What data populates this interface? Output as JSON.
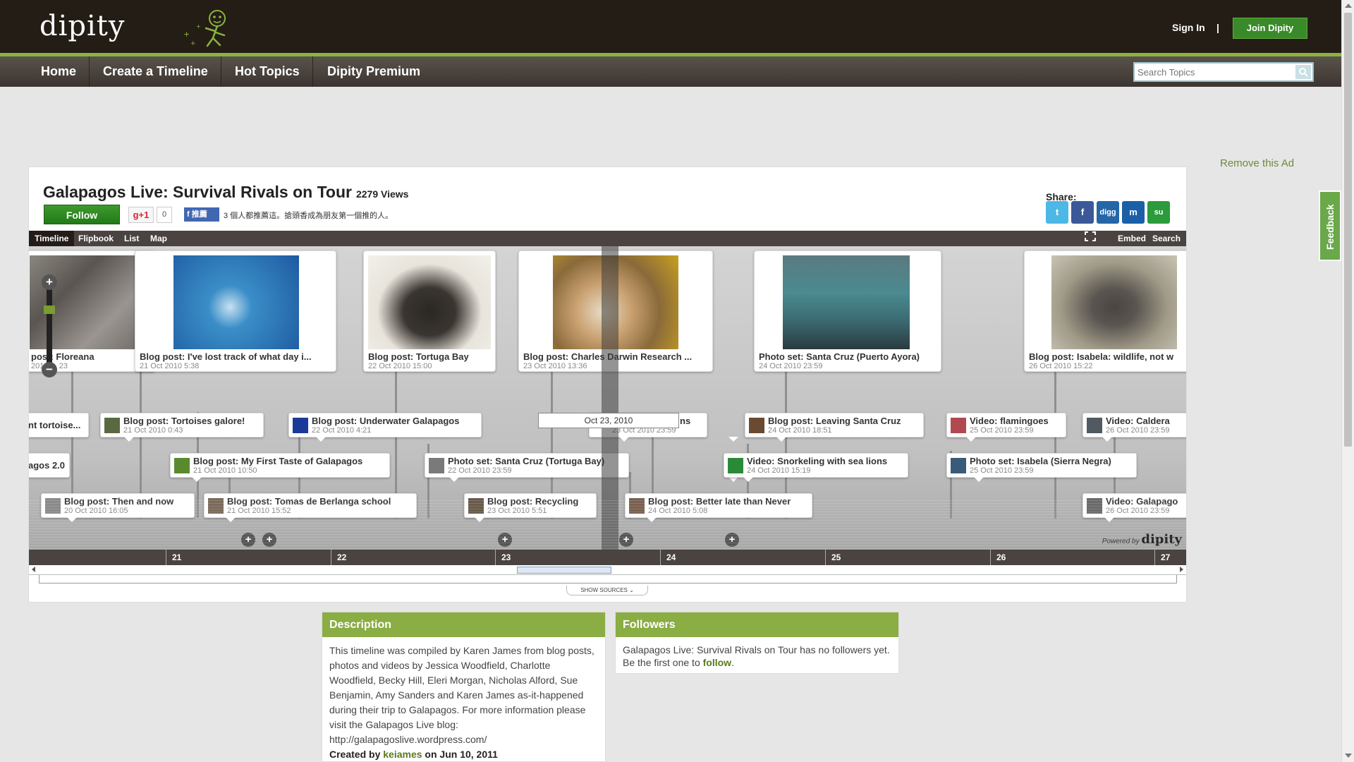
{
  "header": {
    "logo_text": "dipity",
    "signin": "Sign In",
    "separator": "|",
    "join": "Join Dipity"
  },
  "nav": {
    "items": [
      "Home",
      "Create a Timeline",
      "Hot Topics",
      "Dipity Premium"
    ],
    "search_placeholder": "Search Topics"
  },
  "ad": {
    "remove": "Remove this Ad"
  },
  "feedback": "Feedback",
  "timeline": {
    "title": "Galapagos Live: Survival Rivals on Tour",
    "views": "2279 Views",
    "follow": "Follow",
    "gplus": "g+1",
    "gplus_count": "0",
    "fb_button": "推薦",
    "fb_text": "3 個人都推薦這。搶頭香成為朋友第一個推的人。",
    "share_label": "Share:",
    "share_icons": [
      "twitter-icon",
      "facebook-icon",
      "digg-icon",
      "myspace-icon",
      "stumbleupon-icon"
    ],
    "share_glyphs": [
      "t",
      "f",
      "digg",
      "m",
      "su"
    ],
    "tabs": [
      "Timeline",
      "Flipbook",
      "List",
      "Map"
    ],
    "right_tabs": [
      "Embed",
      "Search"
    ],
    "cards": [
      {
        "title": "post: Floreana",
        "date": "2010 ... 23"
      },
      {
        "title": "Blog post: I've lost track of what day i...",
        "date": "21 Oct 2010 5:38"
      },
      {
        "title": "Blog post: Tortuga Bay",
        "date": "22 Oct 2010 15:00"
      },
      {
        "title": "Blog post: Charles Darwin Research ...",
        "date": "23 Oct 2010 13:36"
      },
      {
        "title": "Photo set: Santa Cruz (Puerto Ayora)",
        "date": "24 Oct 2010 23:59"
      },
      {
        "title": "Blog post: Isabela: wildlife, not w",
        "date": "26 Oct 2010 15:22"
      }
    ],
    "events": [
      {
        "title": "nt tortoise...",
        "date": ""
      },
      {
        "title": "Blog post: Tortoises galore!",
        "date": "21 Oct 2010 0:43"
      },
      {
        "title": "Blog post: Underwater Galapagos",
        "date": "22 Oct 2010 4:21"
      },
      {
        "title": "ns",
        "date": "23 Oct 2010 23:59"
      },
      {
        "title": "Blog post: Leaving Santa Cruz",
        "date": "24 Oct 2010 18:51"
      },
      {
        "title": "Video: flamingoes",
        "date": "25 Oct 2010 23:59"
      },
      {
        "title": "Video: Caldera",
        "date": "26 Oct 2010 23:59"
      },
      {
        "title": "agos 2.0",
        "date": ""
      },
      {
        "title": "Blog post: My First Taste of Galapagos",
        "date": "21 Oct 2010 10:50"
      },
      {
        "title": "Photo set: Santa Cruz (Tortuga Bay)",
        "date": "22 Oct 2010 23:59"
      },
      {
        "title": "Video: Snorkeling with sea lions",
        "date": "24 Oct 2010 15:19"
      },
      {
        "title": "Photo set: Isabela (Sierra Negra)",
        "date": "25 Oct 2010 23:59"
      },
      {
        "title": "Blog post: Then and now",
        "date": "20 Oct 2010 16:05"
      },
      {
        "title": "Blog post: Tomas de Berlanga school",
        "date": "21 Oct 2010 15:52"
      },
      {
        "title": "Blog post: Recycling",
        "date": "23 Oct 2010 5:51"
      },
      {
        "title": "Blog post: Better late than Never",
        "date": "24 Oct 2010 5:08"
      },
      {
        "title": "Video: Galapago",
        "date": "26 Oct 2010 23:59"
      }
    ],
    "cursor_label": "Oct 23, 2010",
    "powered_by": "Powered by",
    "powered_logo": "dipity",
    "axis_ticks": [
      "21",
      "22",
      "23",
      "24",
      "25",
      "26",
      "27"
    ],
    "show_sources": "SHOW SOURCES"
  },
  "description": {
    "heading": "Description",
    "text": "This timeline was compiled by Karen James from blog posts, photos and videos by Jessica Woodfield, Charlotte Woodfield, Becky Hill, Eleri Morgan, Nicholas Alford, Sue Benjamin, Amy Sanders and Karen James as-it-happened during their trip to Galapagos. For more information please visit the Galapagos Live blog: http://galapagoslive.wordpress.com/",
    "created_prefix": "Created by",
    "created_user": "keiames",
    "created_suffix": "on Jun 10, 2011"
  },
  "followers": {
    "heading": "Followers",
    "text": "Galapagos Live: Survival Rivals on Tour has no followers yet. Be the first one to",
    "link": "follow"
  }
}
